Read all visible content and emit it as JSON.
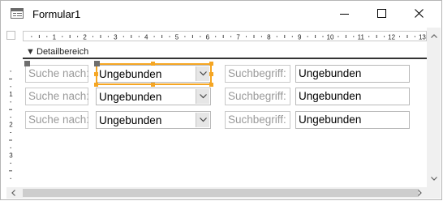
{
  "window": {
    "title": "Formular1",
    "icon": "form-window-icon",
    "buttons": [
      "minimize-icon",
      "maximize-icon",
      "close-icon"
    ]
  },
  "section": {
    "label": "Detailbereich"
  },
  "ruler": {
    "h_numbers": [
      "1",
      "2",
      "3",
      "4",
      "5",
      "6",
      "7",
      "8",
      "9",
      "10",
      "11",
      "12",
      "13"
    ],
    "v_numbers": [
      "1",
      "2",
      "3"
    ]
  },
  "rows": [
    {
      "search_label": "Suche nach:",
      "combo_value": "Ungebunden",
      "term_label": "Suchbegriff:",
      "term_value": "Ungebunden"
    },
    {
      "search_label": "Suche nach:",
      "combo_value": "Ungebunden",
      "term_label": "Suchbegriff:",
      "term_value": "Ungebunden"
    },
    {
      "search_label": "Suche nach:",
      "combo_value": "Ungebunden",
      "term_label": "Suchbegriff:",
      "term_value": "Ungebunden"
    }
  ],
  "colors": {
    "selection": "#f5a623",
    "label_text": "#9a9a9a"
  }
}
